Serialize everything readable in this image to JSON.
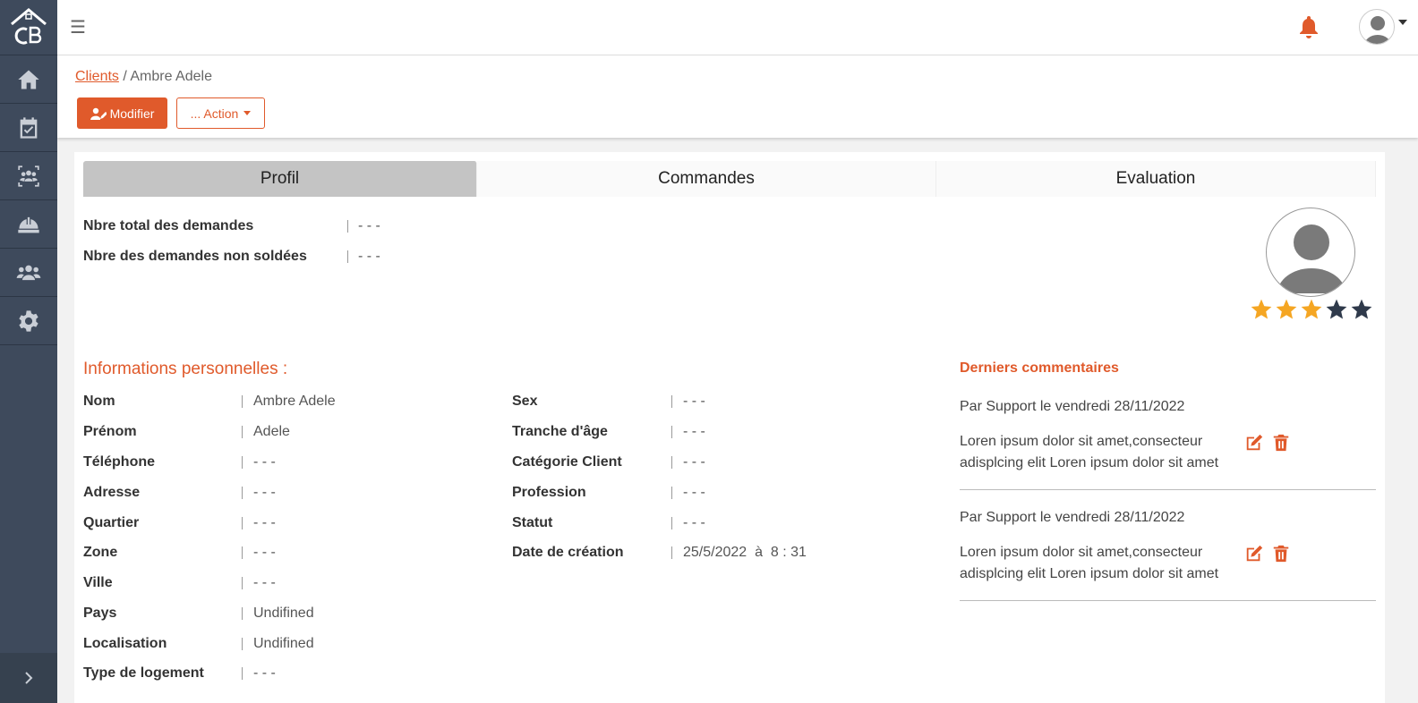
{
  "breadcrumb": {
    "parent": "Clients",
    "separator": " / ",
    "current": "Ambre Adele"
  },
  "toolbar": {
    "modifier_label": "Modifier",
    "action_label": "... Action"
  },
  "tabs": [
    {
      "label": "Profil",
      "active": true
    },
    {
      "label": "Commandes",
      "active": false
    },
    {
      "label": "Evaluation",
      "active": false
    }
  ],
  "stats": [
    {
      "label": "Nbre total des demandes",
      "value": "- - -"
    },
    {
      "label": "Nbre des demandes non soldées",
      "value": "- - -"
    }
  ],
  "rating": {
    "value": 3,
    "max": 5,
    "filled_color": "#f5a623",
    "empty_color": "#2f3a4b"
  },
  "section_title": "Informations personnelles :",
  "personal_left": [
    {
      "label": "Nom",
      "value": "Ambre Adele"
    },
    {
      "label": "Prénom",
      "value": "Adele"
    },
    {
      "label": "Téléphone",
      "value": "- - -"
    },
    {
      "label": "Adresse",
      "value": "- - -"
    },
    {
      "label": "Quartier",
      "value": "- - -"
    },
    {
      "label": "Zone",
      "value": "- - -"
    },
    {
      "label": "Ville",
      "value": "- - -"
    },
    {
      "label": "Pays",
      "value": "Undifined"
    },
    {
      "label": "Localisation",
      "value": "Undifined"
    },
    {
      "label": "Type de logement",
      "value": "- - -"
    }
  ],
  "personal_right": [
    {
      "label": "Sex",
      "value": "- - -"
    },
    {
      "label": "Tranche d'âge",
      "value": "- - -"
    },
    {
      "label": "Catégorie Client",
      "value": "- - -"
    },
    {
      "label": "Profession",
      "value": "- - -"
    },
    {
      "label": "Statut",
      "value": "- - -"
    },
    {
      "label": "Date de création",
      "value": "25/5/2022  à  8 : 31"
    }
  ],
  "comments": {
    "title": "Derniers commentaires",
    "items": [
      {
        "by": "Par Support le vendredi 28/11/2022",
        "text": "Loren ipsum dolor sit amet,consecteur adisplcing elit Loren ipsum dolor sit amet"
      },
      {
        "by": "Par Support le vendredi 28/11/2022",
        "text": "Loren ipsum dolor sit amet,consecteur adisplcing elit Loren ipsum dolor sit amet"
      }
    ]
  },
  "colors": {
    "accent": "#e05a2b",
    "sidebar": "#3e4a5c",
    "notification": "#e05a2b"
  },
  "icons": {
    "sidebar": [
      "home-icon",
      "calendar-check-icon",
      "team-icon",
      "hard-hat-icon",
      "users-icon",
      "gear-icon"
    ],
    "expand": "chevron-right-icon",
    "topbar": [
      "hamburger-icon",
      "bell-icon",
      "user-avatar-icon"
    ]
  }
}
